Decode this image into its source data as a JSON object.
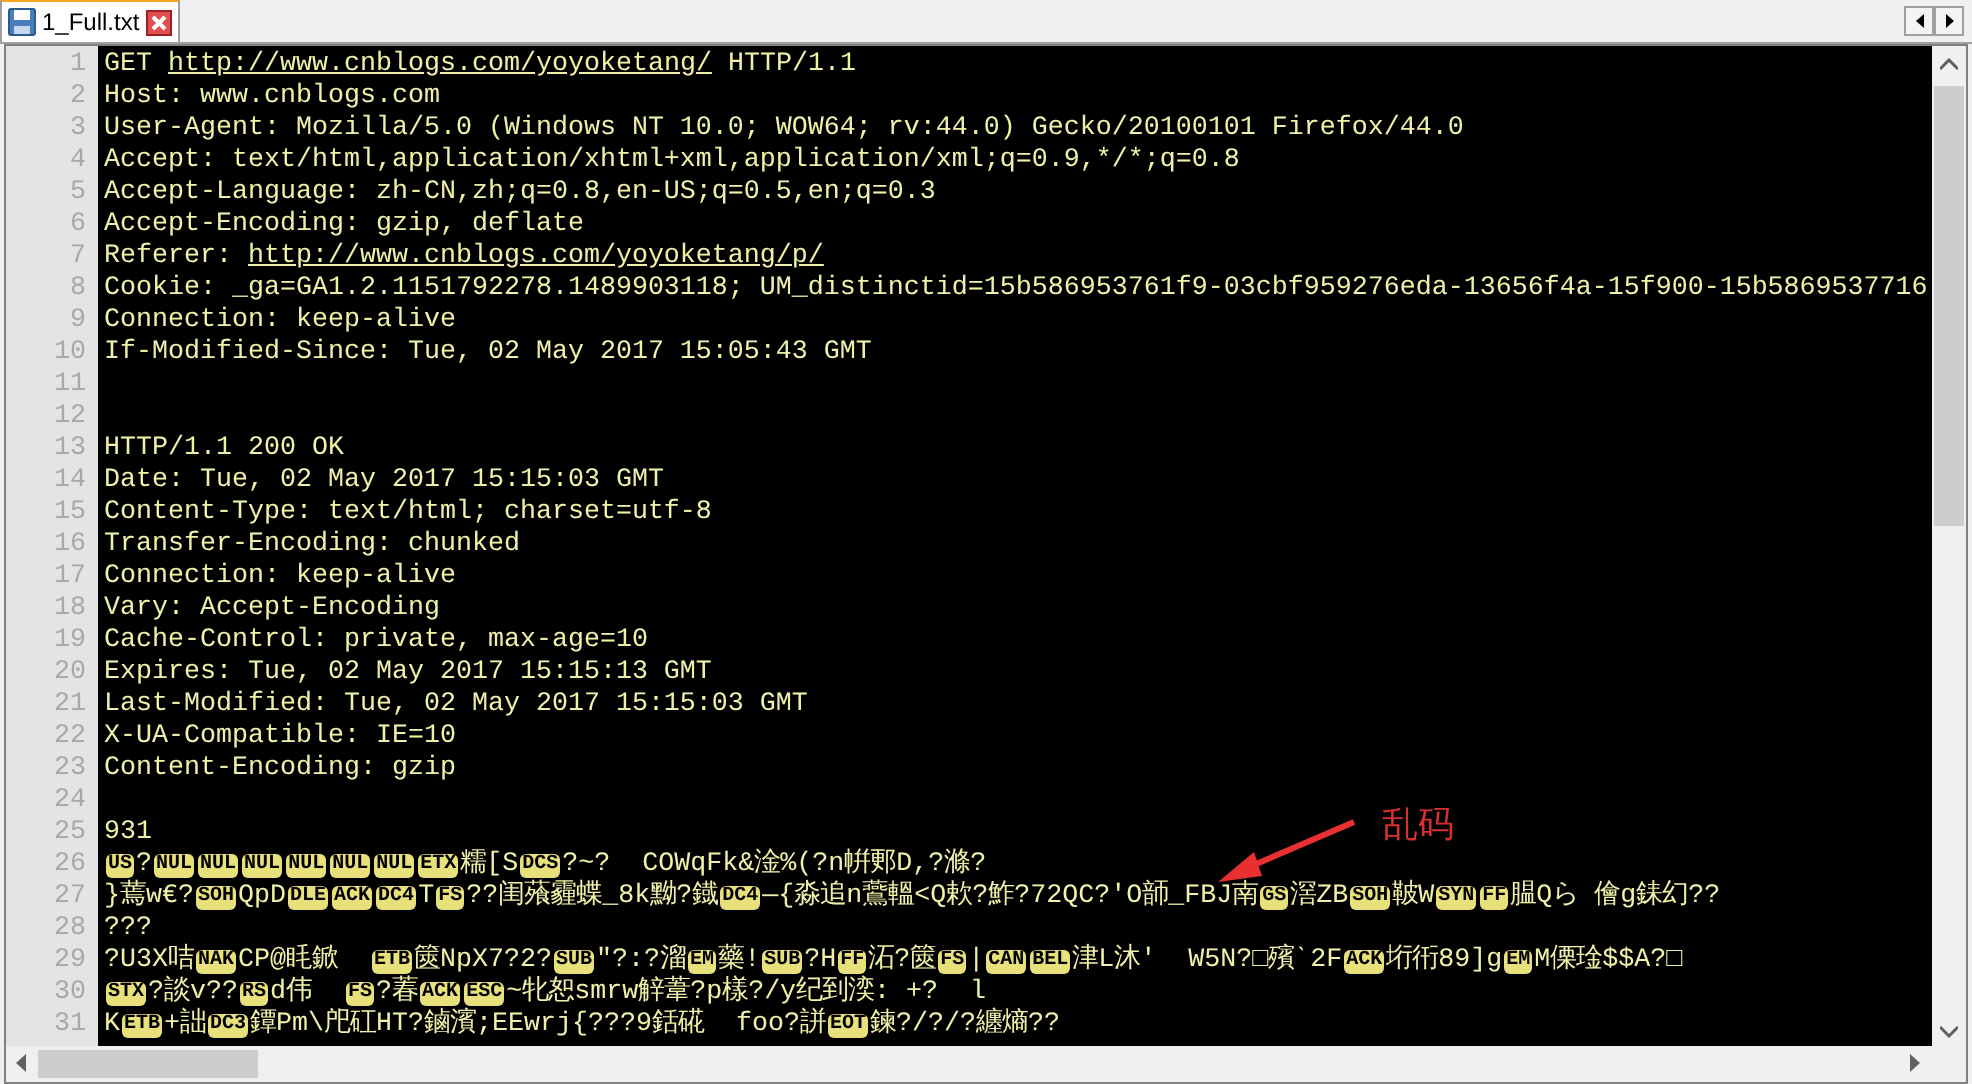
{
  "tabs": [
    {
      "label": "1_Full.txt",
      "selected": true
    }
  ],
  "lines": [
    {
      "number": "1",
      "segments": [
        {
          "kind": "text",
          "text": "GET "
        },
        {
          "kind": "link",
          "text": "http://www.cnblogs.com/yoyoketang/"
        },
        {
          "kind": "text",
          "text": " HTTP/1.1"
        }
      ]
    },
    {
      "number": "2",
      "segments": [
        {
          "kind": "text",
          "text": "Host: www.cnblogs.com"
        }
      ]
    },
    {
      "number": "3",
      "segments": [
        {
          "kind": "text",
          "text": "User-Agent: Mozilla/5.0 (Windows NT 10.0; WOW64; rv:44.0) Gecko/20100101 Firefox/44.0"
        }
      ]
    },
    {
      "number": "4",
      "segments": [
        {
          "kind": "text",
          "text": "Accept: text/html,application/xhtml+xml,application/xml;q=0.9,*/*;q=0.8"
        }
      ]
    },
    {
      "number": "5",
      "segments": [
        {
          "kind": "text",
          "text": "Accept-Language: zh-CN,zh;q=0.8,en-US;q=0.5,en;q=0.3"
        }
      ]
    },
    {
      "number": "6",
      "segments": [
        {
          "kind": "text",
          "text": "Accept-Encoding: gzip, deflate"
        }
      ]
    },
    {
      "number": "7",
      "segments": [
        {
          "kind": "text",
          "text": "Referer: "
        },
        {
          "kind": "link",
          "text": "http://www.cnblogs.com/yoyoketang/p/"
        }
      ]
    },
    {
      "number": "8",
      "segments": [
        {
          "kind": "text",
          "text": "Cookie: _ga=GA1.2.1151792278.1489903118; UM_distinctid=15b586953761f9-03cbf959276eda-13656f4a-15f900-15b5869537716"
        }
      ]
    },
    {
      "number": "9",
      "segments": [
        {
          "kind": "text",
          "text": "Connection: keep-alive"
        }
      ]
    },
    {
      "number": "10",
      "segments": [
        {
          "kind": "text",
          "text": "If-Modified-Since: Tue, 02 May 2017 15:05:43 GMT"
        }
      ]
    },
    {
      "number": "11"
    },
    {
      "number": "12"
    },
    {
      "number": "13",
      "segments": [
        {
          "kind": "text",
          "text": "HTTP/1.1 200 OK"
        }
      ]
    },
    {
      "number": "14",
      "segments": [
        {
          "kind": "text",
          "text": "Date: Tue, 02 May 2017 15:15:03 GMT"
        }
      ]
    },
    {
      "number": "15",
      "segments": [
        {
          "kind": "text",
          "text": "Content-Type: text/html; charset=utf-8"
        }
      ]
    },
    {
      "number": "16",
      "segments": [
        {
          "kind": "text",
          "text": "Transfer-Encoding: chunked"
        }
      ]
    },
    {
      "number": "17",
      "segments": [
        {
          "kind": "text",
          "text": "Connection: keep-alive"
        }
      ]
    },
    {
      "number": "18",
      "segments": [
        {
          "kind": "text",
          "text": "Vary: Accept-Encoding"
        }
      ]
    },
    {
      "number": "19",
      "segments": [
        {
          "kind": "text",
          "text": "Cache-Control: private, max-age=10"
        }
      ]
    },
    {
      "number": "20",
      "segments": [
        {
          "kind": "text",
          "text": "Expires: Tue, 02 May 2017 15:15:13 GMT"
        }
      ]
    },
    {
      "number": "21",
      "segments": [
        {
          "kind": "text",
          "text": "Last-Modified: Tue, 02 May 2017 15:15:03 GMT"
        }
      ]
    },
    {
      "number": "22",
      "segments": [
        {
          "kind": "text",
          "text": "X-UA-Compatible: IE=10"
        }
      ]
    },
    {
      "number": "23",
      "segments": [
        {
          "kind": "text",
          "text": "Content-Encoding: gzip"
        }
      ]
    },
    {
      "number": "24"
    },
    {
      "number": "25",
      "segments": [
        {
          "kind": "text",
          "text": "931"
        }
      ]
    },
    {
      "number": "26",
      "segments": [
        {
          "kind": "ctrl",
          "text": "US"
        },
        {
          "kind": "text",
          "text": "?"
        },
        {
          "kind": "ctrl",
          "text": "NUL"
        },
        {
          "kind": "ctrl",
          "text": "NUL"
        },
        {
          "kind": "ctrl",
          "text": "NUL"
        },
        {
          "kind": "ctrl",
          "text": "NUL"
        },
        {
          "kind": "ctrl",
          "text": "NUL"
        },
        {
          "kind": "ctrl",
          "text": "NUL"
        },
        {
          "kind": "ctrl",
          "text": "ETX"
        },
        {
          "kind": "text",
          "text": "糯[S"
        },
        {
          "kind": "ctrl",
          "text": "DCS"
        },
        {
          "kind": "text",
          "text": "?~?  COWqFk&淦%(?n帲郠D,?滌?"
        }
      ]
    },
    {
      "number": "27",
      "segments": [
        {
          "kind": "text",
          "text": "}蔫w€?"
        },
        {
          "kind": "ctrl",
          "text": "SOH"
        },
        {
          "kind": "text",
          "text": "QpD"
        },
        {
          "kind": "ctrl",
          "text": "DLE"
        },
        {
          "kind": "ctrl",
          "text": "ACK"
        },
        {
          "kind": "ctrl",
          "text": "DC4"
        },
        {
          "kind": "text",
          "text": "T"
        },
        {
          "kind": "ctrl",
          "text": "FS"
        },
        {
          "kind": "text",
          "text": "??闺蕵霾蝶_8k黝?鐡"
        },
        {
          "kind": "ctrl",
          "text": "DC4"
        },
        {
          "kind": "text",
          "text": "—{淼追n鷰轀<Q欶?鮓?72QC?'O韴_FBJ南"
        },
        {
          "kind": "ctrl",
          "text": "GS"
        },
        {
          "kind": "text",
          "text": "滘ZB"
        },
        {
          "kind": "ctrl",
          "text": "SOH"
        },
        {
          "kind": "text",
          "text": "鞁W"
        },
        {
          "kind": "ctrl",
          "text": "SYN"
        },
        {
          "kind": "ctrl",
          "text": "FF"
        },
        {
          "kind": "text",
          "text": "腽Qら 儈g銇幻??"
        }
      ]
    },
    {
      "number": "28",
      "segments": [
        {
          "kind": "text",
          "text": "???"
        }
      ]
    },
    {
      "number": "29",
      "segments": [
        {
          "kind": "text",
          "text": "?U3X咭"
        },
        {
          "kind": "ctrl",
          "text": "NAK"
        },
        {
          "kind": "text",
          "text": "CP@眊鍁  "
        },
        {
          "kind": "ctrl",
          "text": "ETB"
        },
        {
          "kind": "text",
          "text": "篋NpX7?2?"
        },
        {
          "kind": "ctrl",
          "text": "SUB"
        },
        {
          "kind": "text",
          "text": "\"?:?溜"
        },
        {
          "kind": "ctrl",
          "text": "EM"
        },
        {
          "kind": "text",
          "text": "藥!"
        },
        {
          "kind": "ctrl",
          "text": "SUB"
        },
        {
          "kind": "text",
          "text": "?H"
        },
        {
          "kind": "ctrl",
          "text": "FF"
        },
        {
          "kind": "text",
          "text": "沰?篋"
        },
        {
          "kind": "ctrl",
          "text": "FS"
        },
        {
          "kind": "text",
          "text": "|"
        },
        {
          "kind": "ctrl",
          "text": "CAN"
        },
        {
          "kind": "ctrl",
          "text": "BEL"
        },
        {
          "kind": "text",
          "text": "津L沐'  W5N?□殯ˋ2F"
        },
        {
          "kind": "ctrl",
          "text": "ACK"
        },
        {
          "kind": "text",
          "text": "垳衎89]g"
        },
        {
          "kind": "ctrl",
          "text": "EM"
        },
        {
          "kind": "text",
          "text": "M傈琻$$A?□"
        }
      ]
    },
    {
      "number": "30",
      "segments": [
        {
          "kind": "ctrl",
          "text": "STX"
        },
        {
          "kind": "text",
          "text": "?談v??"
        },
        {
          "kind": "ctrl",
          "text": "RS"
        },
        {
          "kind": "text",
          "text": "d伟  "
        },
        {
          "kind": "ctrl",
          "text": "FS"
        },
        {
          "kind": "text",
          "text": "?萶"
        },
        {
          "kind": "ctrl",
          "text": "ACK"
        },
        {
          "kind": "ctrl",
          "text": "ESC"
        },
        {
          "kind": "text",
          "text": "~牝恕smrw觪葦?p樣?/y纪到湙: +?  l"
        }
      ]
    },
    {
      "number": "31",
      "segments": [
        {
          "kind": "text",
          "text": "K"
        },
        {
          "kind": "ctrl",
          "text": "ETB"
        },
        {
          "kind": "text",
          "text": "+詘"
        },
        {
          "kind": "ctrl",
          "text": "DC3"
        },
        {
          "kind": "text",
          "text": "鐔Pm\\戺矼HT?鏀濱;EEwrj{???9銛硴  foo?誁"
        },
        {
          "kind": "ctrl",
          "text": "EOT"
        },
        {
          "kind": "text",
          "text": "鍊?/?/?纏熵??"
        }
      ]
    }
  ],
  "annotation": {
    "text": "乱码"
  }
}
